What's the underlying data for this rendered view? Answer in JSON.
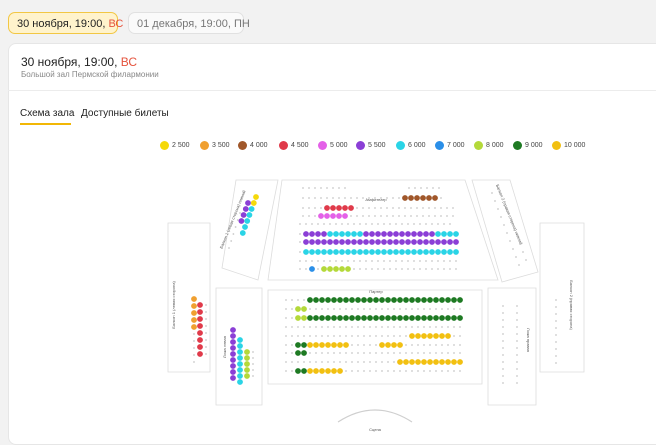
{
  "dates": [
    {
      "date": "30 ноября, 19:00,",
      "dow": "ВС"
    },
    {
      "date": "01 декабря, 19:00, ПН",
      "dow": ""
    }
  ],
  "event": {
    "date": "30 ноября, 19:00,",
    "dow": "ВС",
    "venue": "Большой зал Пермской филармонии"
  },
  "tabs": [
    "Схема зала",
    "Доступные билеты"
  ],
  "prices": [
    {
      "label": "2 500",
      "color": "#f5d90a"
    },
    {
      "label": "3 500",
      "color": "#f0a030"
    },
    {
      "label": "4 000",
      "color": "#a0572a"
    },
    {
      "label": "4 500",
      "color": "#e03a4a"
    },
    {
      "label": "5 000",
      "color": "#e461e8"
    },
    {
      "label": "5 500",
      "color": "#8b3fd6"
    },
    {
      "label": "6 000",
      "color": "#2ad4e6"
    },
    {
      "label": "7 000",
      "color": "#2b8fe8"
    },
    {
      "label": "8 000",
      "color": "#b4d93a"
    },
    {
      "label": "9 000",
      "color": "#1e7a23"
    },
    {
      "label": "10 000",
      "color": "#f2c011"
    }
  ],
  "hall": {
    "sections": [
      "Амфитеатр",
      "Партер",
      "Сцена",
      "Балкон 1 (левая сторона)",
      "Балкон 2 (правая сторона)",
      "Ложа левая",
      "Ложа правая",
      "Балкон 1 (левая сторона) нижний",
      "Балкон 2 (правая сторона) нижний"
    ]
  }
}
